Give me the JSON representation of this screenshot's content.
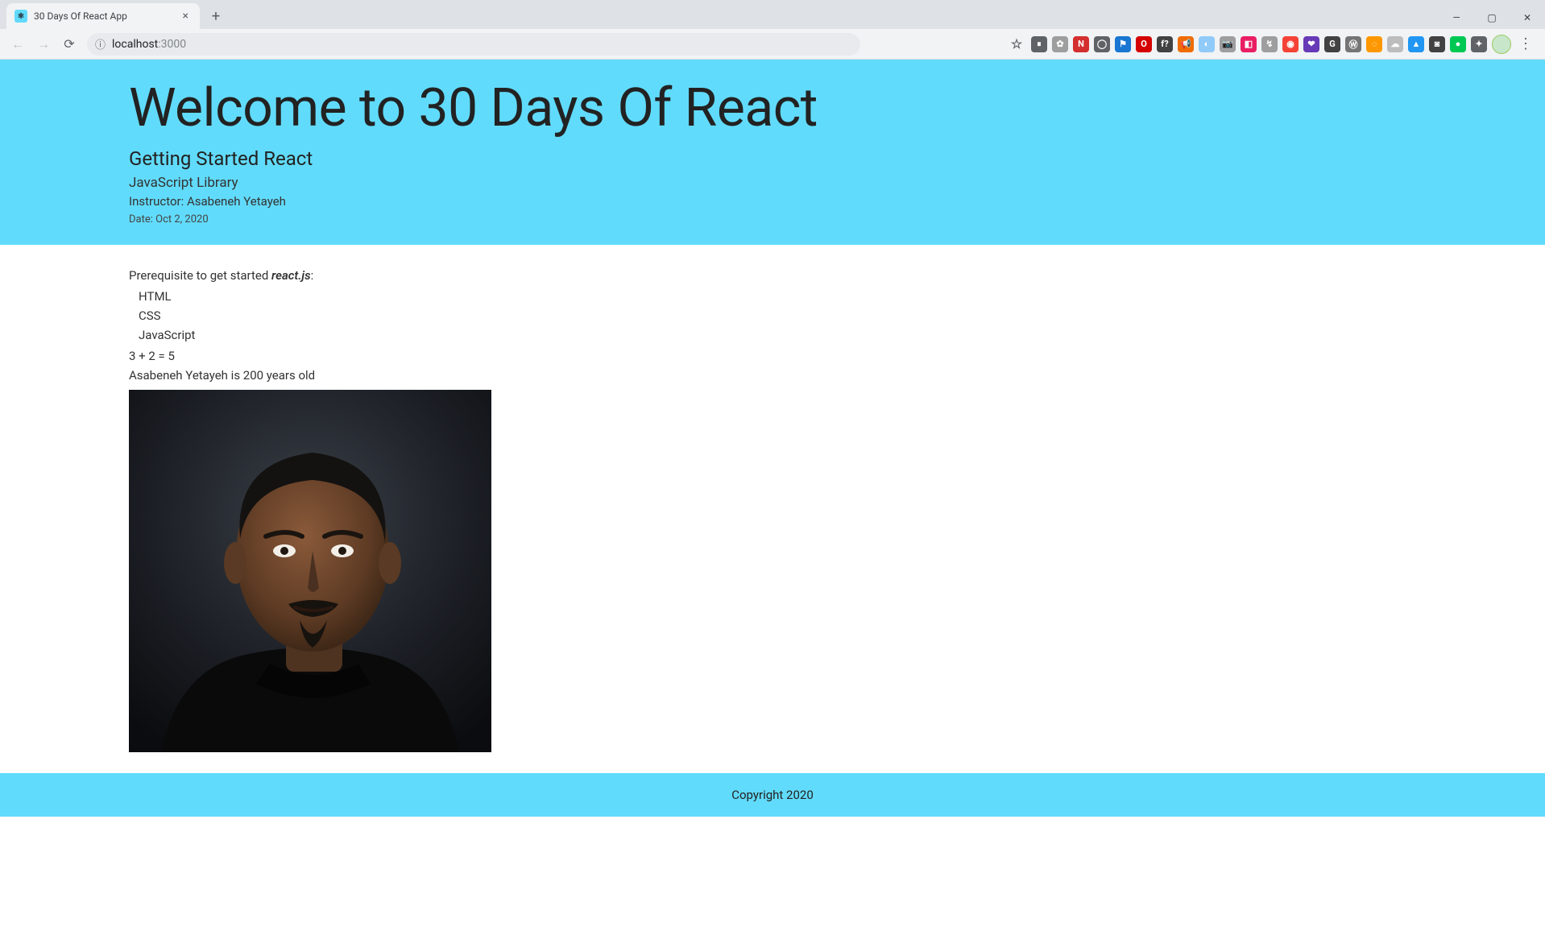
{
  "browser": {
    "tab_title": "30 Days Of React App",
    "url_host": "localhost",
    "url_port": ":3000"
  },
  "extension_icons": [
    {
      "bg": "#5f6368",
      "txt": "⏸"
    },
    {
      "bg": "#9e9e9e",
      "txt": "✿"
    },
    {
      "bg": "#d32f2f",
      "txt": "N"
    },
    {
      "bg": "#5f6368",
      "txt": "◯"
    },
    {
      "bg": "#1976d2",
      "txt": "⚑"
    },
    {
      "bg": "#d50000",
      "txt": "O"
    },
    {
      "bg": "#424242",
      "txt": "f?"
    },
    {
      "bg": "#ef6c00",
      "txt": "📢"
    },
    {
      "bg": "#90caf9",
      "txt": "◐"
    },
    {
      "bg": "#9e9e9e",
      "txt": "📷"
    },
    {
      "bg": "#e91e63",
      "txt": "◧"
    },
    {
      "bg": "#9e9e9e",
      "txt": "↯"
    },
    {
      "bg": "#f44336",
      "txt": "◉"
    },
    {
      "bg": "#673ab7",
      "txt": "❤"
    },
    {
      "bg": "#424242",
      "txt": "G"
    },
    {
      "bg": "#757575",
      "txt": "Ⓦ"
    },
    {
      "bg": "#ff9800",
      "txt": "◌"
    },
    {
      "bg": "#bdbdbd",
      "txt": "☁"
    },
    {
      "bg": "#2196f3",
      "txt": "▲"
    },
    {
      "bg": "#424242",
      "txt": "◙"
    },
    {
      "bg": "#00c853",
      "txt": "●"
    },
    {
      "bg": "#5f6368",
      "txt": "✦"
    }
  ],
  "hero": {
    "title": "Welcome to 30 Days Of React",
    "subtitle": "Getting Started React",
    "tagline": "JavaScript Library",
    "instructor": "Instructor: Asabeneh Yetayeh",
    "date": "Date: Oct 2, 2020"
  },
  "main": {
    "prereq_prefix": "Prerequisite to get started ",
    "prereq_em": "react.js",
    "prereq_suffix": ":",
    "skills": [
      "HTML",
      "CSS",
      "JavaScript"
    ],
    "math": "3 + 2 = 5",
    "age_line": "Asabeneh Yetayeh is 200 years old",
    "portrait_alt": "asabeneh"
  },
  "footer": {
    "copyright": "Copyright 2020"
  }
}
